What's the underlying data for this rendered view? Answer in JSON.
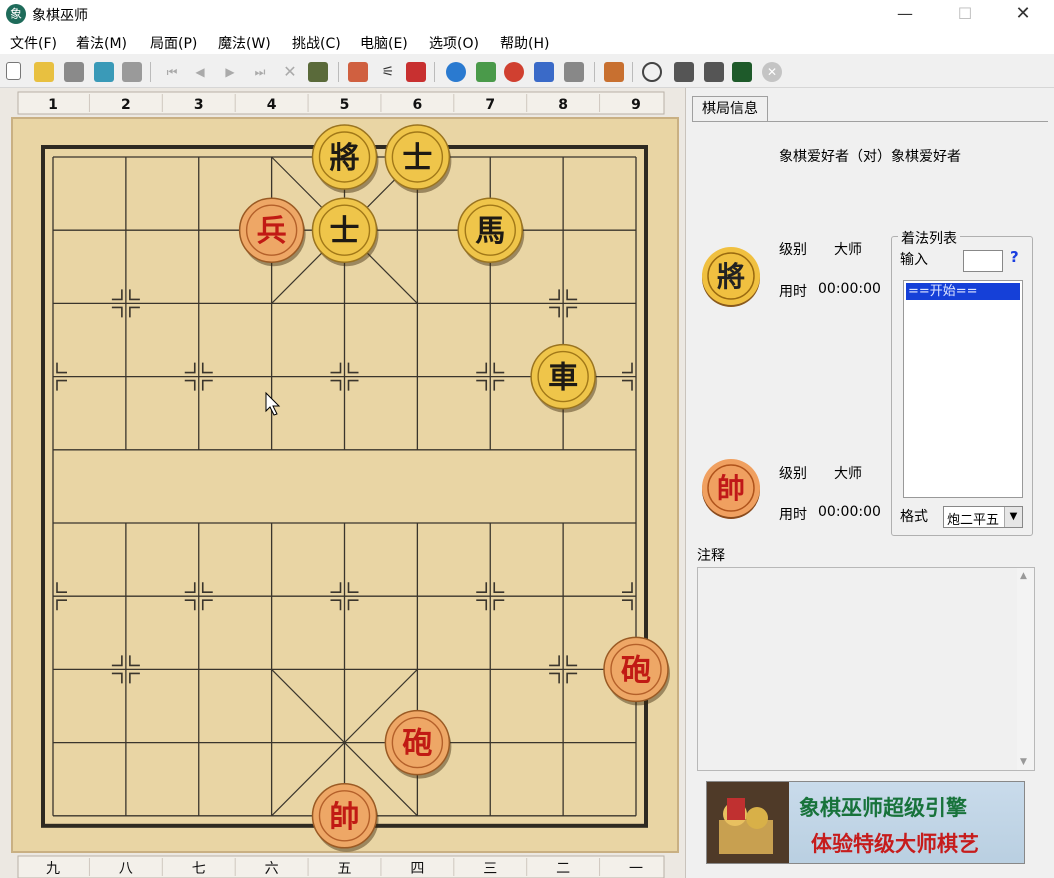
{
  "window": {
    "title": "象棋巫师",
    "icon_char": "象"
  },
  "menu": [
    "文件(F)",
    "着法(M)",
    "局面(P)",
    "魔法(W)",
    "挑战(C)",
    "电脑(E)",
    "选项(O)",
    "帮助(H)"
  ],
  "board": {
    "top_labels": [
      "1",
      "2",
      "3",
      "4",
      "5",
      "6",
      "7",
      "8",
      "9"
    ],
    "bottom_labels": [
      "九",
      "八",
      "七",
      "六",
      "五",
      "四",
      "三",
      "二",
      "一"
    ],
    "pieces": [
      {
        "char": "將",
        "side": "black",
        "file": 5,
        "rank": 1
      },
      {
        "char": "士",
        "side": "black",
        "file": 6,
        "rank": 1
      },
      {
        "char": "兵",
        "side": "red",
        "file": 4,
        "rank": 2
      },
      {
        "char": "士",
        "side": "black",
        "file": 5,
        "rank": 2
      },
      {
        "char": "馬",
        "side": "black",
        "file": 7,
        "rank": 2
      },
      {
        "char": "車",
        "side": "black",
        "file": 8,
        "rank": 4
      },
      {
        "char": "砲",
        "side": "red",
        "file": 9,
        "rank": 8
      },
      {
        "char": "砲",
        "side": "red",
        "file": 6,
        "rank": 9
      },
      {
        "char": "帥",
        "side": "red",
        "file": 5,
        "rank": 10
      }
    ]
  },
  "panel": {
    "tab": "棋局信息",
    "match_title": "象棋爱好者（对）象棋爱好者",
    "black": {
      "piece": "將",
      "level_label": "级别",
      "level": "大师",
      "time_label": "用时",
      "time": "00:00:00"
    },
    "red": {
      "piece": "帥",
      "level_label": "级别",
      "level": "大师",
      "time_label": "用时",
      "time": "00:00:00"
    },
    "moves": {
      "legend": "着法列表",
      "input_label": "输入",
      "help": "?",
      "start": "==开始==",
      "format_label": "格式",
      "format_value": "炮二平五"
    },
    "notes_label": "注释"
  },
  "ad": {
    "line1": "象棋巫师超级引擎",
    "line2": "体验特级大师棋艺"
  }
}
